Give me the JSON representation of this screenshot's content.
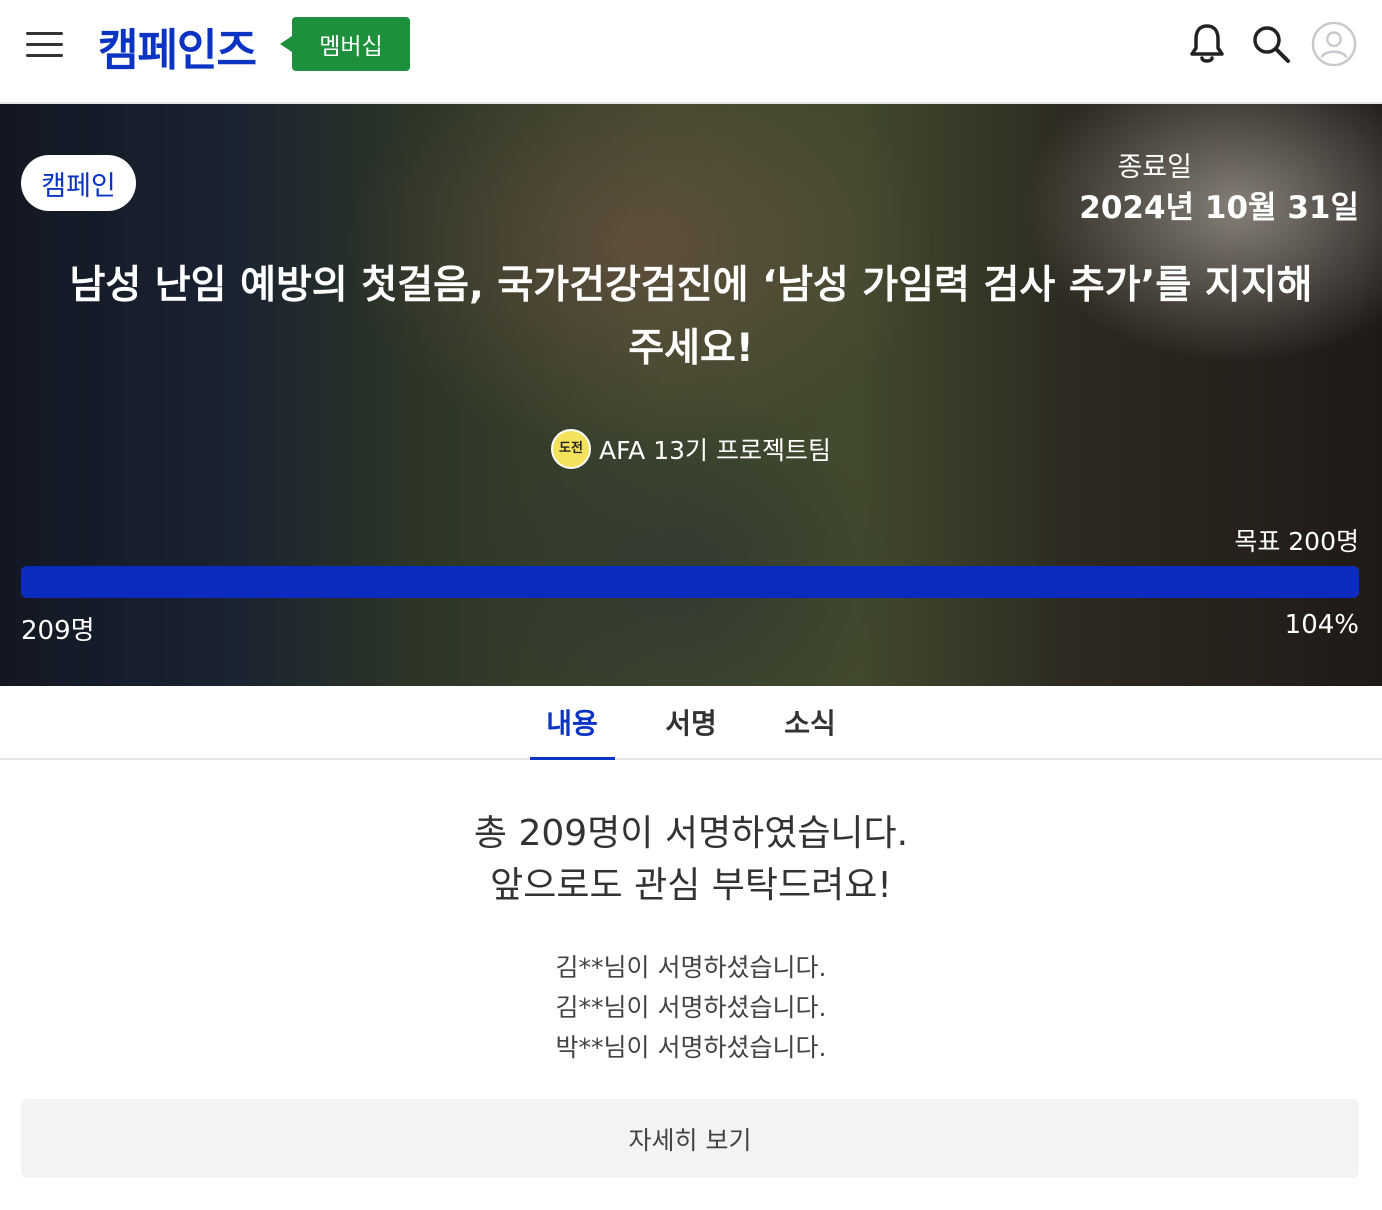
{
  "header": {
    "logo": "캠페인즈",
    "membership_label": "멤버십"
  },
  "icons": {
    "menu": "hamburger-menu-icon",
    "notification": "bell-icon",
    "search": "search-icon",
    "profile": "user-avatar-icon"
  },
  "colors": {
    "brand": "#0b34c4",
    "membership": "#1e8f3a",
    "progress": "#0a2bbd"
  },
  "campaign": {
    "badge": "캠페인",
    "end_label": "종료일",
    "end_date": "2024년 10월 31일",
    "title_line1": "남성 난임 예방의 첫걸음, 국가건강검진에 ‘남성 가임력 검사 추가’를 지지해",
    "title_line2": "주세요!",
    "organizer": "AFA 13기 프로젝트팀",
    "organizer_logo_text": "도전",
    "goal": "목표 200명",
    "count": "209명",
    "percent_label": "104%",
    "progress_fraction": 1.0
  },
  "tabs": [
    {
      "label": "내용",
      "active": true
    },
    {
      "label": "서명",
      "active": false
    },
    {
      "label": "소식",
      "active": false
    }
  ],
  "content": {
    "summary_line1": "총 209명이 서명하였습니다.",
    "summary_line2": "앞으로도 관심 부탁드려요!",
    "signers": [
      "김**님이 서명하셨습니다.",
      "김**님이 서명하셨습니다.",
      "박**님이 서명하셨습니다."
    ],
    "more_button": "자세히 보기"
  }
}
